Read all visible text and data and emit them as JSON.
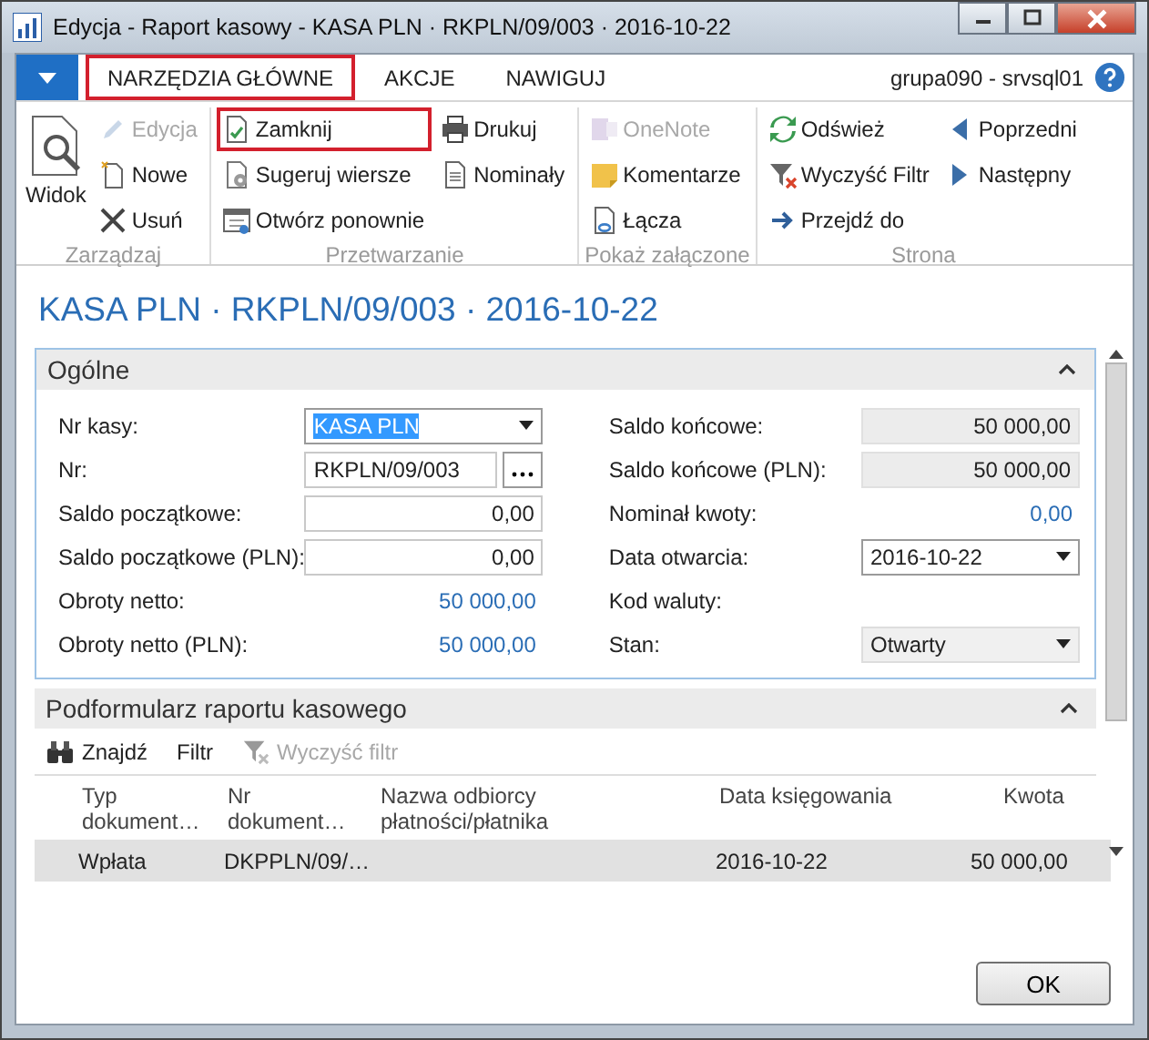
{
  "window": {
    "title": "Edycja - Raport kasowy - KASA PLN · RKPLN/09/003 · 2016-10-22"
  },
  "ribbon_tabs": [
    {
      "label": "NARZĘDZIA GŁÓWNE",
      "highlighted": true
    },
    {
      "label": "AKCJE",
      "highlighted": false
    },
    {
      "label": "NAWIGUJ",
      "highlighted": false
    }
  ],
  "user": "grupa090 - srvsql01",
  "ribbon_groups": [
    {
      "label": "Zarządzaj",
      "large": {
        "label": "Widok"
      },
      "columns": [
        [
          {
            "label": "Edycja",
            "disabled": true,
            "highlighted": false
          },
          {
            "label": "Nowe",
            "disabled": false,
            "highlighted": false
          },
          {
            "label": "Usuń",
            "disabled": false,
            "highlighted": false
          }
        ]
      ]
    },
    {
      "label": "Przetwarzanie",
      "columns": [
        [
          {
            "label": "Zamknij",
            "disabled": false,
            "highlighted": true
          },
          {
            "label": "Sugeruj wiersze",
            "disabled": false,
            "highlighted": false
          },
          {
            "label": "Otwórz ponownie",
            "disabled": false,
            "highlighted": false
          }
        ],
        [
          {
            "label": "Drukuj",
            "disabled": false,
            "highlighted": false
          },
          {
            "label": "Nominały",
            "disabled": false,
            "highlighted": false
          }
        ]
      ]
    },
    {
      "label": "Pokaż załączone",
      "columns": [
        [
          {
            "label": "OneNote",
            "disabled": true,
            "highlighted": false
          },
          {
            "label": "Komentarze",
            "disabled": false,
            "highlighted": false
          },
          {
            "label": "Łącza",
            "disabled": false,
            "highlighted": false
          }
        ]
      ]
    },
    {
      "label": "Strona",
      "columns": [
        [
          {
            "label": "Odśwież",
            "disabled": false,
            "highlighted": false
          },
          {
            "label": "Wyczyść Filtr",
            "disabled": false,
            "highlighted": false
          },
          {
            "label": "Przejdź do",
            "disabled": false,
            "highlighted": false
          }
        ],
        [
          {
            "label": "Poprzedni",
            "disabled": false,
            "highlighted": false
          },
          {
            "label": "Następny",
            "disabled": false,
            "highlighted": false
          }
        ]
      ]
    }
  ],
  "page_title": "KASA PLN · RKPLN/09/003 · 2016-10-22",
  "general": {
    "title": "Ogólne",
    "expanded": true,
    "left_fields": [
      {
        "label": "Nr kasy:",
        "kind": "dropdown",
        "value": "KASA PLN",
        "text_selected": true
      },
      {
        "label": "Nr:",
        "kind": "lookup",
        "value": "RKPLN/09/003"
      },
      {
        "label": "Saldo początkowe:",
        "kind": "input",
        "value": "0,00"
      },
      {
        "label": "Saldo początkowe (PLN):",
        "kind": "input",
        "value": "0,00"
      },
      {
        "label": "Obroty netto:",
        "kind": "link",
        "value": "50 000,00"
      },
      {
        "label": "Obroty netto (PLN):",
        "kind": "link",
        "value": "50 000,00"
      }
    ],
    "right_fields": [
      {
        "label": "Saldo końcowe:",
        "kind": "readonly",
        "value": "50 000,00"
      },
      {
        "label": "Saldo końcowe (PLN):",
        "kind": "readonly",
        "value": "50 000,00"
      },
      {
        "label": "Nominał kwoty:",
        "kind": "link",
        "value": "0,00"
      },
      {
        "label": "Data otwarcia:",
        "kind": "dropdown",
        "value": "2016-10-22"
      },
      {
        "label": "Kod waluty:",
        "kind": "label"
      },
      {
        "label": "Stan:",
        "kind": "select",
        "value": "Otwarty"
      }
    ]
  },
  "subform": {
    "title": "Podformularz raportu kasowego",
    "expanded": true,
    "actions": [
      {
        "label": "Znajdź",
        "disabled": false
      },
      {
        "label": "Filtr",
        "disabled": false
      },
      {
        "label": "Wyczyść filtr",
        "disabled": true
      }
    ],
    "columns": [
      "Typ dokument…",
      "Nr dokument…",
      "Nazwa odbiorcy płatności/płatnika",
      "Data księgowania",
      "Kwota"
    ],
    "rows": [
      {
        "selected": true,
        "cells": [
          "Wpłata",
          "DKPPLN/09/…",
          "",
          "2016-10-22",
          "50 000,00"
        ]
      }
    ]
  },
  "buttons": [
    "OK"
  ]
}
